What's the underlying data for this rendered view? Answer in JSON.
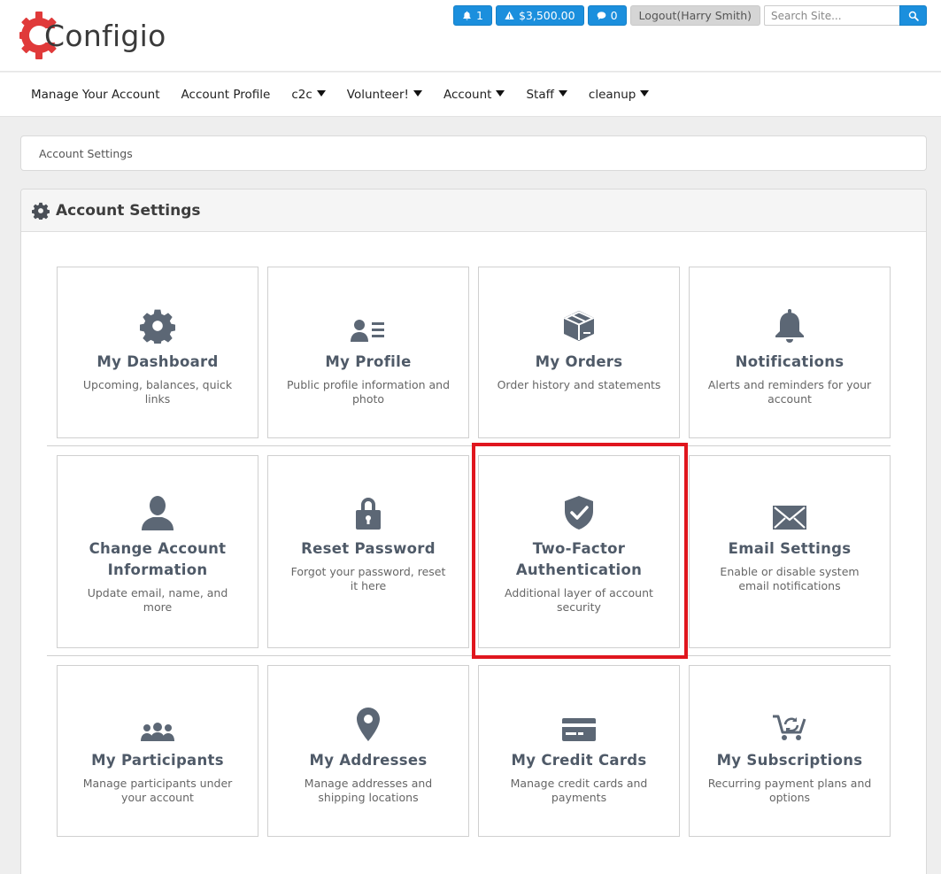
{
  "brand": {
    "logo_text": "Configio",
    "accent_color": "#1b8fdd",
    "logo_color": "#e03a3a"
  },
  "topbar": {
    "notifications_count": "1",
    "balance": "$3,500.00",
    "messages_count": "0",
    "logout_label": "Logout(Harry Smith)",
    "search_placeholder": "Search Site..."
  },
  "nav": {
    "items": [
      {
        "label": "Manage Your Account",
        "dropdown": false
      },
      {
        "label": "Account Profile",
        "dropdown": false
      },
      {
        "label": "c2c",
        "dropdown": true
      },
      {
        "label": "Volunteer!",
        "dropdown": true
      },
      {
        "label": "Account",
        "dropdown": true
      },
      {
        "label": "Staff",
        "dropdown": true
      },
      {
        "label": "cleanup",
        "dropdown": true
      }
    ]
  },
  "breadcrumb": {
    "label": "Account Settings"
  },
  "panel": {
    "title": "Account Settings",
    "icon": "gear-icon"
  },
  "tiles": [
    {
      "title": "My Dashboard",
      "desc": "Upcoming, balances, quick links",
      "icon": "gear-icon"
    },
    {
      "title": "My Profile",
      "desc": "Public profile information and photo",
      "icon": "profile-card-icon"
    },
    {
      "title": "My Orders",
      "desc": "Order history and statements",
      "icon": "box-icon"
    },
    {
      "title": "Notifications",
      "desc": "Alerts and reminders for your account",
      "icon": "bell-icon"
    },
    {
      "title": "Change Account Information",
      "desc": "Update email, name, and more",
      "icon": "user-icon"
    },
    {
      "title": "Reset Password",
      "desc": "Forgot your password, reset it here",
      "icon": "lock-icon"
    },
    {
      "title": "Two-Factor Authentication",
      "desc": "Additional layer of account security",
      "icon": "shield-check-icon"
    },
    {
      "title": "Email Settings",
      "desc": "Enable or disable system email notifications",
      "icon": "envelope-icon"
    },
    {
      "title": "My Participants",
      "desc": "Manage participants under your account",
      "icon": "group-icon"
    },
    {
      "title": "My Addresses",
      "desc": "Manage addresses and shipping locations",
      "icon": "map-pin-icon"
    },
    {
      "title": "My Credit Cards",
      "desc": "Manage credit cards and payments",
      "icon": "credit-card-icon"
    },
    {
      "title": "My Subscriptions",
      "desc": "Recurring payment plans and options",
      "icon": "cart-refresh-icon"
    }
  ]
}
